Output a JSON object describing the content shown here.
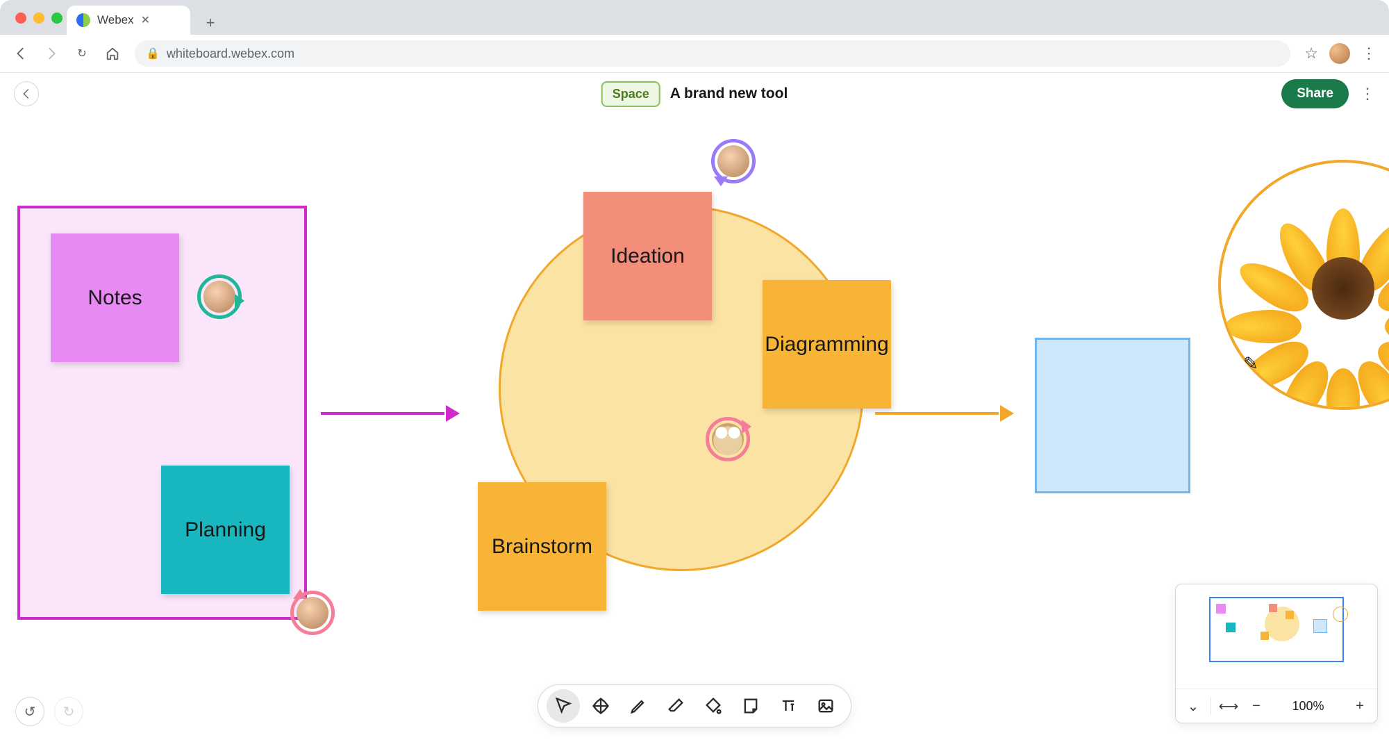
{
  "browser": {
    "tab_title": "Webex",
    "url": "whiteboard.webex.com"
  },
  "header": {
    "space_label": "Space",
    "doc_title": "A brand new tool",
    "share_label": "Share"
  },
  "notes": {
    "notes": "Notes",
    "planning": "Planning",
    "ideation": "Ideation",
    "diagramming": "Diagramming",
    "brainstorm": "Brainstorm"
  },
  "toolbar": {
    "select": "select",
    "pan": "pan",
    "pen": "pen",
    "eraser": "eraser",
    "fill": "fill",
    "sticky": "sticky-note",
    "text": "text",
    "image": "image"
  },
  "zoom": {
    "value": "100%"
  },
  "icons": {
    "back": "‹",
    "fwd": "›",
    "reload": "↻",
    "home": "⌂",
    "lock": "🔒",
    "star": "☆",
    "menu": "⋮",
    "undo": "↺",
    "redo": "↻",
    "plus": "+",
    "minus": "−",
    "fit": "⟷",
    "dropdown": "⌄",
    "close": "✕",
    "pencil": "✎"
  }
}
